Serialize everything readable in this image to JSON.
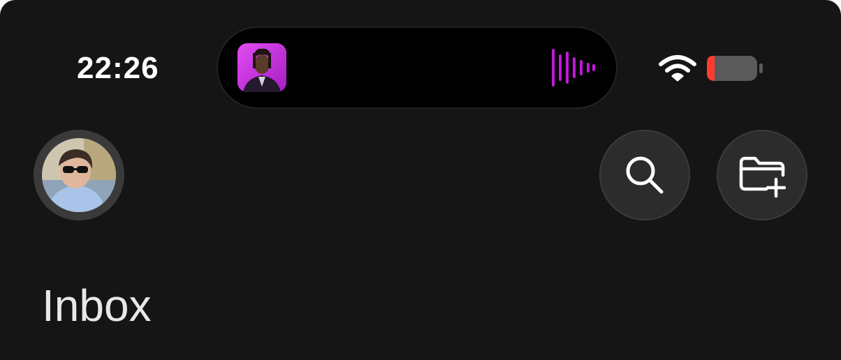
{
  "status_bar": {
    "time": "22:26",
    "wifi_icon": "wifi-icon",
    "battery_icon": "battery-low-icon",
    "battery_level_percent": 5,
    "battery_color": "#ff3b30"
  },
  "dynamic_island": {
    "activity": "now-playing",
    "artwork_icon": "album-artwork",
    "waveform_icon": "audio-waveform-icon",
    "accent_color": "#c018d8"
  },
  "toolbar": {
    "avatar_icon": "profile-avatar",
    "search_icon": "search-icon",
    "new_folder_icon": "folder-plus-icon"
  },
  "main": {
    "title": "Inbox"
  }
}
